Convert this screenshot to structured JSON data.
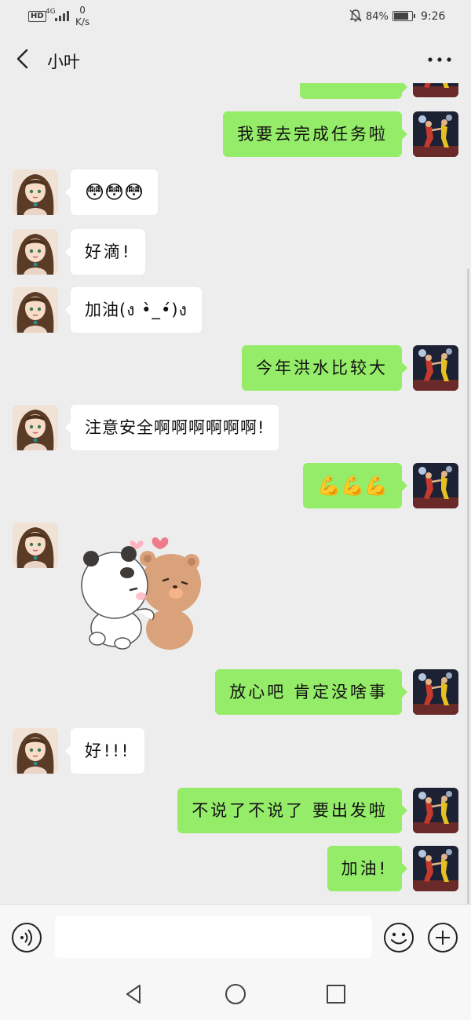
{
  "status_bar": {
    "hd": "HD",
    "network": "4G",
    "speed_value": "0",
    "speed_unit": "K/s",
    "battery_percent": "84%",
    "battery_level": 0.84,
    "time": "9:26"
  },
  "header": {
    "title": "小叶"
  },
  "messages": [
    {
      "side": "right",
      "kind": "text",
      "text": "我要去完成任务啦"
    },
    {
      "side": "left",
      "kind": "emoji",
      "text": "😳😳😳"
    },
    {
      "side": "left",
      "kind": "text",
      "text": "好滴!"
    },
    {
      "side": "left",
      "kind": "text",
      "text": "加油(ง •̀_•́)ง"
    },
    {
      "side": "right",
      "kind": "text",
      "text": "今年洪水比较大"
    },
    {
      "side": "left",
      "kind": "text",
      "text": "注意安全啊啊啊啊啊啊!"
    },
    {
      "side": "right",
      "kind": "emoji",
      "text": "💪💪💪"
    },
    {
      "side": "left",
      "kind": "sticker",
      "sticker": "hugging-bears-sticker"
    },
    {
      "side": "right",
      "kind": "text",
      "text": "放心吧 肯定没啥事"
    },
    {
      "side": "left",
      "kind": "text",
      "text": "好!!!"
    },
    {
      "side": "right",
      "kind": "text",
      "text": "不说了不说了 要出发啦"
    },
    {
      "side": "right",
      "kind": "text",
      "text": "加油!"
    }
  ],
  "input": {
    "value": "",
    "placeholder": ""
  },
  "icons": {
    "back": "chevron-left-icon",
    "more": "more-dots-icon",
    "voice": "voice-icon",
    "emoji": "emoji-icon",
    "plus": "plus-icon"
  },
  "colors": {
    "background": "#ededed",
    "sent_bubble": "#95ec69",
    "received_bubble": "#ffffff"
  }
}
